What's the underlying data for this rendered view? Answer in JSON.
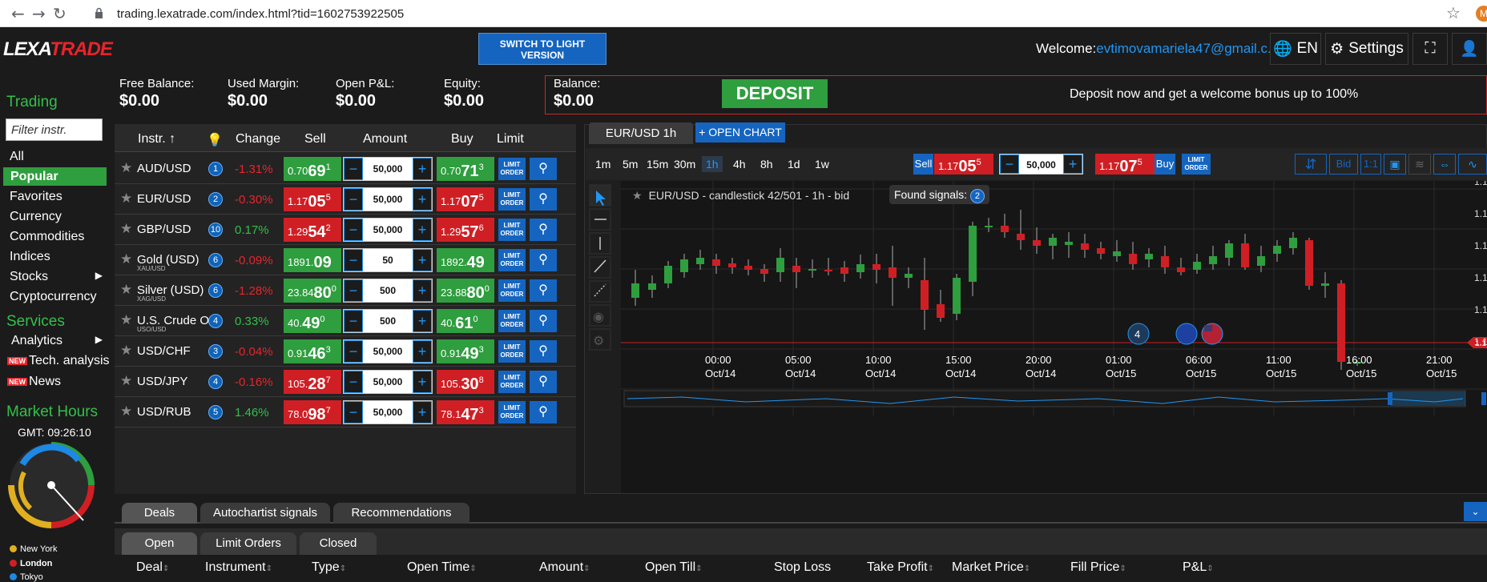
{
  "browser": {
    "url": "trading.lexatrade.com/index.html?tid=1602753922505",
    "avatar": "M"
  },
  "header": {
    "logo_a": "LEXA",
    "logo_b": "TRADE",
    "light_btn": "SWITCH TO LIGHT VERSION",
    "welcome": "Welcome:",
    "email": "evtimovamariela47@gmail.c...",
    "lang": "EN",
    "settings": "Settings"
  },
  "balances": [
    {
      "label": "Free Balance:",
      "value": "$0.00"
    },
    {
      "label": "Used Margin:",
      "value": "$0.00"
    },
    {
      "label": "Open P&L:",
      "value": "$0.00"
    },
    {
      "label": "Equity:",
      "value": "$0.00"
    },
    {
      "label": "Balance:",
      "value": "$0.00"
    }
  ],
  "deposit": {
    "button": "DEPOSIT",
    "bonus": "Deposit now and get a welcome bonus up to 100%"
  },
  "sidebar": {
    "trading": "Trading",
    "filter_placeholder": "Filter instr.",
    "items": [
      "All",
      "Popular",
      "Favorites",
      "Currency",
      "Commodities",
      "Indices",
      "Stocks",
      "Cryptocurrency"
    ],
    "services": "Services",
    "service_items": [
      "Analytics",
      "Tech. analysis",
      "News"
    ],
    "new_badge": "NEW",
    "market_hours": "Market Hours",
    "gmt": "GMT: 09:26:10",
    "cities": [
      "New York",
      "London",
      "Tokyo"
    ]
  },
  "table": {
    "headers": {
      "instr": "Instr.",
      "change": "Change",
      "sell": "Sell",
      "amount": "Amount",
      "buy": "Buy",
      "limit": "Limit"
    },
    "limit_label": "LIMIT ORDER",
    "rows": [
      {
        "name": "AUD/USD",
        "sub": "",
        "sig": "1",
        "change": "-1.31%",
        "dir": "neg",
        "sell": [
          "0.70",
          "69",
          "1"
        ],
        "sellc": "pg",
        "amount": "50,000",
        "buy": [
          "0.70",
          "71",
          "3"
        ],
        "buyc": "pg"
      },
      {
        "name": "EUR/USD",
        "sub": "",
        "sig": "2",
        "change": "-0.30%",
        "dir": "neg",
        "sell": [
          "1.17",
          "05",
          "5"
        ],
        "sellc": "pr",
        "amount": "50,000",
        "buy": [
          "1.17",
          "07",
          "5"
        ],
        "buyc": "pr"
      },
      {
        "name": "GBP/USD",
        "sub": "",
        "sig": "10",
        "change": "0.17%",
        "dir": "pos",
        "sell": [
          "1.29",
          "54",
          "2"
        ],
        "sellc": "pr",
        "amount": "50,000",
        "buy": [
          "1.29",
          "57",
          "6"
        ],
        "buyc": "pr"
      },
      {
        "name": "Gold (USD)",
        "sub": "XAU/USD",
        "sig": "6",
        "change": "-0.09%",
        "dir": "neg",
        "sell": [
          "1891.",
          "09",
          ""
        ],
        "sellc": "pg",
        "amount": "50",
        "buy": [
          "1892.",
          "49",
          ""
        ],
        "buyc": "pg"
      },
      {
        "name": "Silver (USD)",
        "sub": "XAG/USD",
        "sig": "6",
        "change": "-1.28%",
        "dir": "neg",
        "sell": [
          "23.84",
          "80",
          "0"
        ],
        "sellc": "pg",
        "amount": "500",
        "buy": [
          "23.88",
          "80",
          "0"
        ],
        "buyc": "pg"
      },
      {
        "name": "U.S. Crude O",
        "sub": "USO/USD",
        "sig": "4",
        "change": "0.33%",
        "dir": "pos",
        "sell": [
          "40.",
          "49",
          "0"
        ],
        "sellc": "pg",
        "amount": "500",
        "buy": [
          "40.",
          "61",
          "0"
        ],
        "buyc": "pg"
      },
      {
        "name": "USD/CHF",
        "sub": "",
        "sig": "3",
        "change": "-0.04%",
        "dir": "neg",
        "sell": [
          "0.91",
          "46",
          "3"
        ],
        "sellc": "pg",
        "amount": "50,000",
        "buy": [
          "0.91",
          "49",
          "3"
        ],
        "buyc": "pg"
      },
      {
        "name": "USD/JPY",
        "sub": "",
        "sig": "4",
        "change": "-0.16%",
        "dir": "neg",
        "sell": [
          "105.",
          "28",
          "7"
        ],
        "sellc": "pr",
        "amount": "50,000",
        "buy": [
          "105.",
          "30",
          "8"
        ],
        "buyc": "pr"
      },
      {
        "name": "USD/RUB",
        "sub": "",
        "sig": "5",
        "change": "1.46%",
        "dir": "pos",
        "sell": [
          "78.0",
          "98",
          "7"
        ],
        "sellc": "pr",
        "amount": "50,000",
        "buy": [
          "78.1",
          "47",
          "3"
        ],
        "buyc": "pr"
      }
    ]
  },
  "chart": {
    "tab": "EUR/USD 1h",
    "open_chart": "+ OPEN CHART",
    "timeframes": [
      "1m",
      "5m",
      "15m",
      "30m",
      "1h",
      "4h",
      "8h",
      "1d",
      "1w"
    ],
    "active_tf": "1h",
    "sell_label": "Sell",
    "buy_label": "Buy",
    "sell_price": [
      "1.17",
      "05",
      "5"
    ],
    "buy_price": [
      "1.17",
      "07",
      "5"
    ],
    "amount": "50,000",
    "limit_label": "LIMIT ORDER",
    "bid_label": "Bid",
    "ratio": "1:1",
    "title": "EUR/USD - candlestick 42/501 - 1h - bid",
    "found_signals": "Found signals:",
    "signals_count": "2",
    "marker_count": "4",
    "price_stub": "1.1"
  },
  "chart_data": {
    "type": "candlestick",
    "x_labels": [
      [
        "00:00",
        "Oct/14"
      ],
      [
        "05:00",
        "Oct/14"
      ],
      [
        "10:00",
        "Oct/14"
      ],
      [
        "15:00",
        "Oct/14"
      ],
      [
        "20:00",
        "Oct/14"
      ],
      [
        "01:00",
        "Oct/15"
      ],
      [
        "06:00",
        "Oct/15"
      ],
      [
        "11:00",
        "Oct/15"
      ],
      [
        "16:00",
        "Oct/15"
      ],
      [
        "21:00",
        "Oct/15"
      ]
    ],
    "y_labels": [
      "1.1",
      "1.1",
      "1.1",
      "1.1",
      "1.1",
      "1.1"
    ]
  },
  "bottom": {
    "tabs": [
      "Deals",
      "Autochartist signals",
      "Recommendations"
    ],
    "subtabs": [
      "Open",
      "Limit Orders",
      "Closed"
    ],
    "columns": [
      "Deal",
      "Instrument",
      "Type",
      "Open Time",
      "Amount",
      "Open Till",
      "Stop Loss",
      "Take Profit",
      "Market Price",
      "Fill Price",
      "P&L"
    ]
  },
  "colors": {
    "green": "#2e9e3e",
    "red": "#d01f24",
    "blue": "#1565c0",
    "accent": "#2196f3"
  }
}
